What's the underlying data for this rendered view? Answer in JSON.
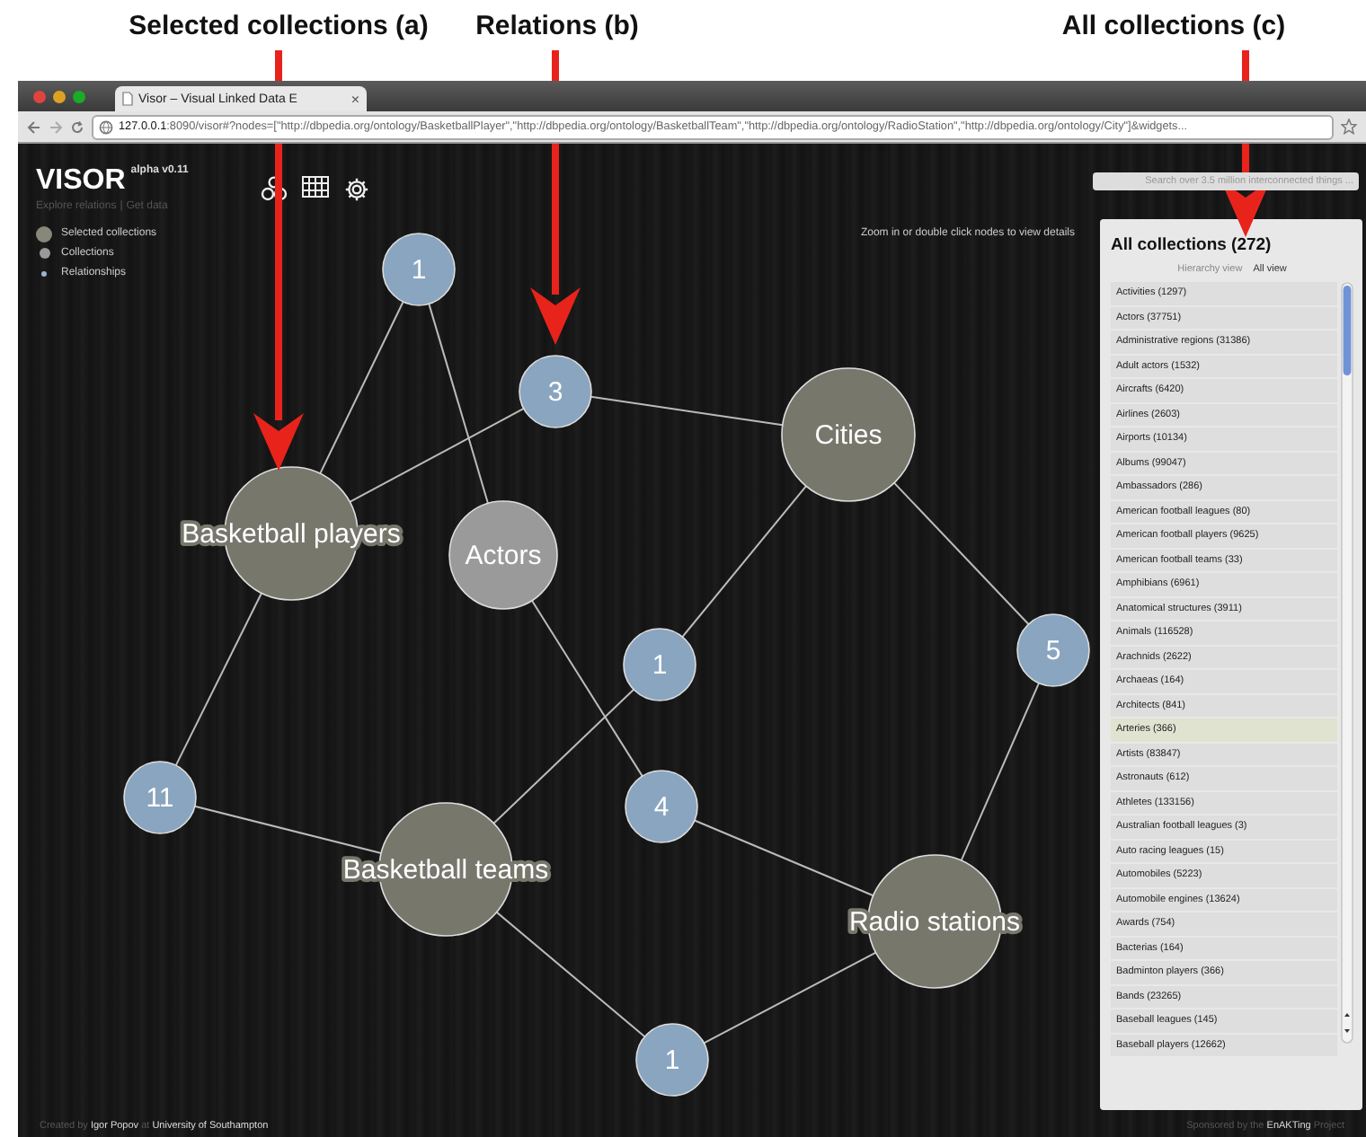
{
  "annotations": [
    {
      "label": "Selected collections (a)"
    },
    {
      "label": "Relations (b)"
    },
    {
      "label": "All collections (c)"
    }
  ],
  "browser": {
    "tab_title": "Visor – Visual Linked Data E",
    "tab_close": "×",
    "url_host": "127.0.0.1",
    "url_rest": ":8090/visor#?nodes=[\"http://dbpedia.org/ontology/BasketballPlayer\",\"http://dbpedia.org/ontology/BasketballTeam\",\"http://dbpedia.org/ontology/RadioStation\",\"http://dbpedia.org/ontology/City\"]&widgets..."
  },
  "app": {
    "title": "VISOR",
    "version": "alpha v0.11",
    "links": [
      "Explore relations",
      "Get data"
    ],
    "link_separator": "|",
    "legend": [
      {
        "kind": "selected",
        "label": "Selected collections"
      },
      {
        "kind": "collection",
        "label": "Collections"
      },
      {
        "kind": "relation",
        "label": "Relationships"
      }
    ],
    "hint": "Zoom in or double click nodes to view details",
    "search": {
      "placeholder": "Search over 3.5 million interconnected things ..."
    }
  },
  "graph": {
    "nodes": [
      {
        "kind": "relation",
        "label": "1"
      },
      {
        "kind": "relation",
        "label": "3"
      },
      {
        "kind": "selected",
        "label": "Cities"
      },
      {
        "kind": "selected",
        "label": "Basketball players"
      },
      {
        "kind": "collection",
        "label": "Actors"
      },
      {
        "kind": "relation",
        "label": "1"
      },
      {
        "kind": "relation",
        "label": "5"
      },
      {
        "kind": "relation",
        "label": "11"
      },
      {
        "kind": "relation",
        "label": "4"
      },
      {
        "kind": "selected",
        "label": "Basketball teams"
      },
      {
        "kind": "selected",
        "label": "Radio stations"
      },
      {
        "kind": "relation",
        "label": "1"
      }
    ]
  },
  "panel": {
    "title": "All collections (272)",
    "views": [
      {
        "label": "Hierarchy view",
        "selected": false
      },
      {
        "label": "All view",
        "selected": true
      }
    ],
    "items": [
      {
        "label": "Activities (1297)",
        "selected": false
      },
      {
        "label": "Actors (37751)",
        "selected": false
      },
      {
        "label": "Administrative regions (31386)",
        "selected": false
      },
      {
        "label": "Adult actors (1532)",
        "selected": false
      },
      {
        "label": "Aircrafts (6420)",
        "selected": false
      },
      {
        "label": "Airlines (2603)",
        "selected": false
      },
      {
        "label": "Airports (10134)",
        "selected": false
      },
      {
        "label": "Albums (99047)",
        "selected": false
      },
      {
        "label": "Ambassadors (286)",
        "selected": false
      },
      {
        "label": "American football leagues (80)",
        "selected": false
      },
      {
        "label": "American football players (9625)",
        "selected": false
      },
      {
        "label": "American football teams (33)",
        "selected": false
      },
      {
        "label": "Amphibians (6961)",
        "selected": false
      },
      {
        "label": "Anatomical structures (3911)",
        "selected": false
      },
      {
        "label": "Animals (116528)",
        "selected": false
      },
      {
        "label": "Arachnids (2622)",
        "selected": false
      },
      {
        "label": "Archaeas (164)",
        "selected": false
      },
      {
        "label": "Architects (841)",
        "selected": false
      },
      {
        "label": "Arteries (366)",
        "selected": true
      },
      {
        "label": "Artists (83847)",
        "selected": false
      },
      {
        "label": "Astronauts (612)",
        "selected": false
      },
      {
        "label": "Athletes (133156)",
        "selected": false
      },
      {
        "label": "Australian football leagues (3)",
        "selected": false
      },
      {
        "label": "Auto racing leagues (15)",
        "selected": false
      },
      {
        "label": "Automobiles (5223)",
        "selected": false
      },
      {
        "label": "Automobile engines (13624)",
        "selected": false
      },
      {
        "label": "Awards (754)",
        "selected": false
      },
      {
        "label": "Bacterias (164)",
        "selected": false
      },
      {
        "label": "Badminton players (366)",
        "selected": false
      },
      {
        "label": "Bands (23265)",
        "selected": false
      },
      {
        "label": "Baseball leagues (145)",
        "selected": false
      },
      {
        "label": "Baseball players (12662)",
        "selected": false
      }
    ]
  },
  "footer": {
    "left": "Created by **Igor Popov** at **University of Southampton**",
    "right": "Sponsored by the **EnAKTing** Project"
  }
}
